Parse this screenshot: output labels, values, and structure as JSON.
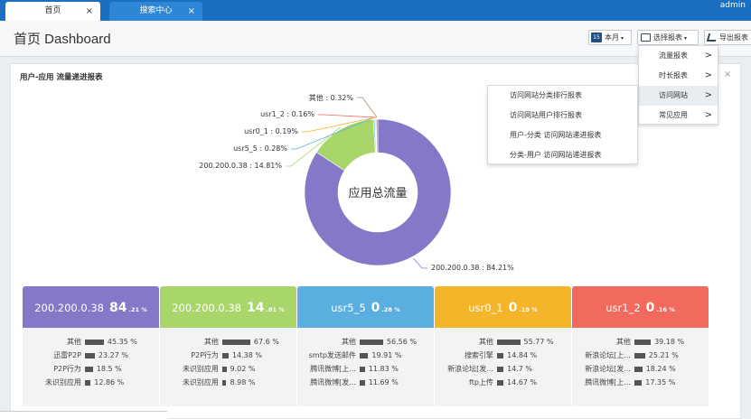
{
  "tabs": [
    {
      "label": "首页",
      "close": "×"
    },
    {
      "label": "搜索中心",
      "close": "×"
    }
  ],
  "user": "admin",
  "page_title": "首页 Dashboard",
  "toolbar": {
    "date_badge": "15",
    "period_label": "本月",
    "report_label": "选择报表",
    "export_label": "导出报表"
  },
  "panel": {
    "title": "用户-应用 流量递进报表",
    "close": "×",
    "center_label": "应用总流量"
  },
  "chart_data": {
    "type": "pie",
    "style": "donut",
    "slices": [
      {
        "label": "200.200.0.38",
        "value": 84.21,
        "color": "#8478c8",
        "text": "200.200.0.38 : 84.21%"
      },
      {
        "label": "200.200.0.38",
        "value": 14.81,
        "color": "#a8d66a",
        "text": "200.200.0.38 : 14.81%"
      },
      {
        "label": "usr5_5",
        "value": 0.28,
        "color": "#5aaee0",
        "text": "usr5_5 : 0.28%"
      },
      {
        "label": "usr0_1",
        "value": 0.19,
        "color": "#f5b52a",
        "text": "usr0_1 : 0.19%"
      },
      {
        "label": "usr1_2",
        "value": 0.16,
        "color": "#f26a5d",
        "text": "usr1_2 : 0.16%"
      },
      {
        "label": "其他",
        "value": 0.32,
        "color": "#b08a6a",
        "text": "其他 : 0.32%"
      }
    ]
  },
  "menu": {
    "items": [
      {
        "label": "流量报表",
        "chevron": ">"
      },
      {
        "label": "时长报表",
        "chevron": ">"
      },
      {
        "label": "访问网站",
        "chevron": ">"
      },
      {
        "label": "常见应用",
        "chevron": ">"
      }
    ],
    "submenu": [
      "访问网站分类排行报表",
      "访问网站用户排行报表",
      "用户-分类 访问网站递进报表",
      "分类-用户 访问网站递进报表"
    ]
  },
  "cards": [
    {
      "name": "200.200.0.38",
      "big": "84",
      "small": ".21 %",
      "color": "#8478c8",
      "rows": [
        {
          "label": "其他",
          "value": "45.35 %",
          "pct": 45.35
        },
        {
          "label": "迅雷P2P",
          "value": "23.27 %",
          "pct": 23.27
        },
        {
          "label": "P2P行为",
          "value": "18.5 %",
          "pct": 18.5
        },
        {
          "label": "未识别应用",
          "value": "12.86 %",
          "pct": 12.86
        }
      ]
    },
    {
      "name": "200.200.0.38",
      "big": "14",
      "small": ".81 %",
      "color": "#a8d66a",
      "rows": [
        {
          "label": "其他",
          "value": "67.6 %",
          "pct": 67.6
        },
        {
          "label": "P2P行为",
          "value": "14.38 %",
          "pct": 14.38
        },
        {
          "label": "未识别应用",
          "value": "9.02 %",
          "pct": 9.02
        },
        {
          "label": "未识别应用",
          "value": "8.98 %",
          "pct": 8.98
        }
      ]
    },
    {
      "name": "usr5_5",
      "big": "0",
      "small": ".28 %",
      "color": "#5aaee0",
      "rows": [
        {
          "label": "其他",
          "value": "56.56 %",
          "pct": 56.56
        },
        {
          "label": "smtp发送邮件",
          "value": "19.91 %",
          "pct": 19.91
        },
        {
          "label": "腾讯微博[上...",
          "value": "11.83 %",
          "pct": 11.83
        },
        {
          "label": "腾讯微博[发...",
          "value": "11.69 %",
          "pct": 11.69
        }
      ]
    },
    {
      "name": "usr0_1",
      "big": "0",
      "small": ".19 %",
      "color": "#f5b52a",
      "rows": [
        {
          "label": "其他",
          "value": "55.77 %",
          "pct": 55.77
        },
        {
          "label": "搜索引擎",
          "value": "14.84 %",
          "pct": 14.84
        },
        {
          "label": "新浪论坛[发...",
          "value": "14.7 %",
          "pct": 14.7
        },
        {
          "label": "ftp上传",
          "value": "14.67 %",
          "pct": 14.67
        }
      ]
    },
    {
      "name": "usr1_2",
      "big": "0",
      "small": ".16 %",
      "color": "#f26a5d",
      "rows": [
        {
          "label": "其他",
          "value": "39.18 %",
          "pct": 39.18
        },
        {
          "label": "新浪论坛[上...",
          "value": "25.21 %",
          "pct": 25.21
        },
        {
          "label": "新浪论坛[发...",
          "value": "18.24 %",
          "pct": 18.24
        },
        {
          "label": "腾讯微博[上...",
          "value": "17.35 %",
          "pct": 17.35
        }
      ]
    }
  ]
}
